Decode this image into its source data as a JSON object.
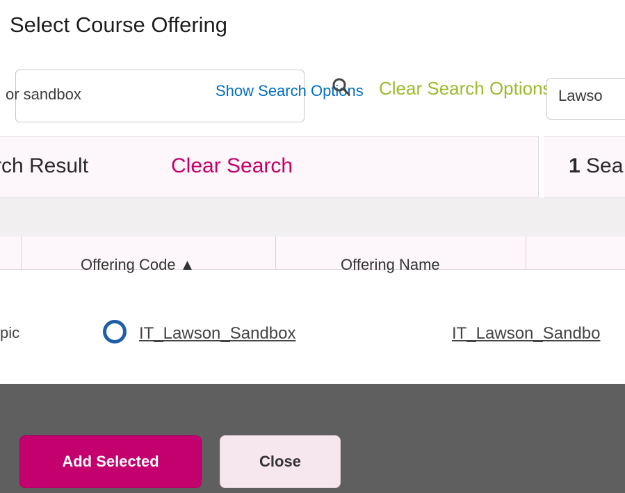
{
  "dialog": {
    "title": "Select Course Offering"
  },
  "search": {
    "value": "or sandbox",
    "show_search_options": "Show Search Options",
    "clear_search_options": "Clear Search Options",
    "right_field_value": "Lawso"
  },
  "results": {
    "count_label": "rch Result",
    "clear_search": "Clear Search",
    "right_count_number": "1",
    "right_count_label": "Sea"
  },
  "table": {
    "headers": {
      "offering_code": "Offering Code ▲",
      "offering_name": "Offering Name"
    },
    "rows": [
      {
        "left_cell": "pic",
        "offering_code": "IT_Lawson_Sandbox",
        "offering_name": "IT_Lawson_Sandbo"
      }
    ]
  },
  "footer": {
    "add_selected": "Add Selected",
    "close": "Close"
  },
  "colors": {
    "primary": "#c4006f",
    "link": "#c40068",
    "footer_bg": "#5f5f5f"
  }
}
